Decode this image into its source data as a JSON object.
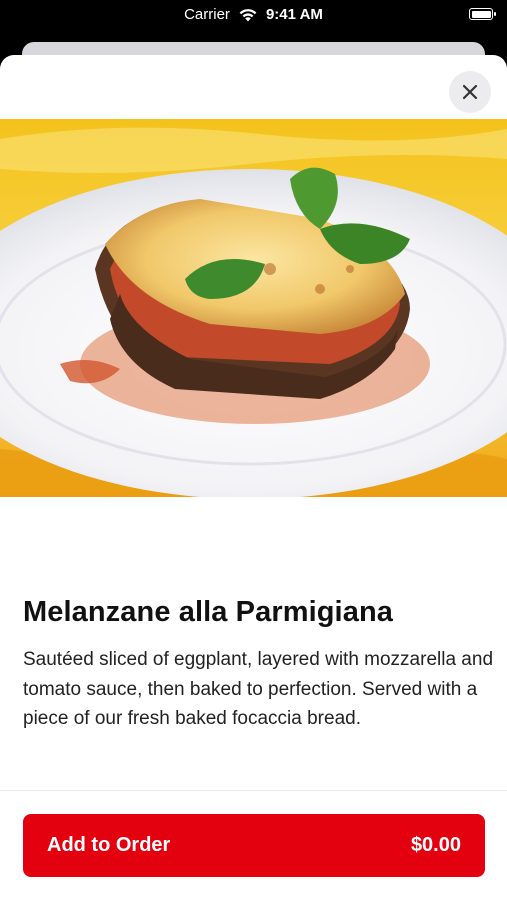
{
  "status_bar": {
    "carrier": "Carrier",
    "time": "9:41 AM"
  },
  "item": {
    "name": "Melanzane alla Parmigiana",
    "description": "Sautéed sliced of eggplant, layered with mozzarella and tomato sauce, then baked to perfection. Served with a piece of our fresh baked focaccia bread."
  },
  "order_button": {
    "label": "Add to Order",
    "price": "$0.00"
  },
  "colors": {
    "accent": "#e3000f"
  },
  "icons": {
    "close": "close-icon",
    "wifi": "wifi-icon",
    "battery": "battery-icon"
  }
}
